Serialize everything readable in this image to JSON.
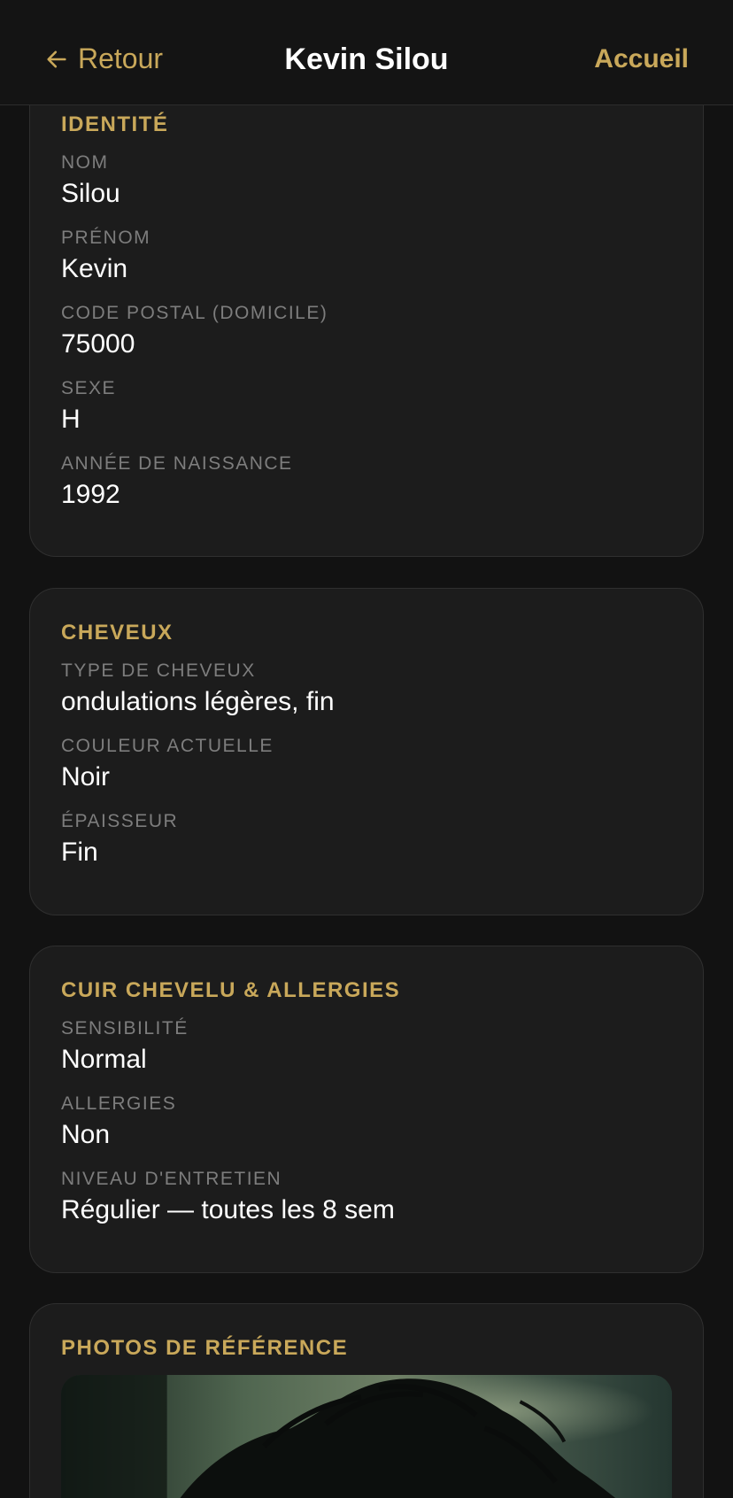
{
  "nav": {
    "back_label": "Retour",
    "title": "Kevin Silou",
    "home_label": "Accueil"
  },
  "identity": {
    "title": "IDENTITÉ",
    "fields": [
      {
        "label": "NOM",
        "value": "Silou"
      },
      {
        "label": "PRÉNOM",
        "value": "Kevin"
      },
      {
        "label": "CODE POSTAL (DOMICILE)",
        "value": "75000"
      },
      {
        "label": "SEXE",
        "value": "H"
      },
      {
        "label": "ANNÉE DE NAISSANCE",
        "value": "1992"
      }
    ]
  },
  "hair": {
    "title": "CHEVEUX",
    "fields": [
      {
        "label": "TYPE DE CHEVEUX",
        "value": "ondulations légères, fin"
      },
      {
        "label": "COULEUR ACTUELLE",
        "value": "Noir"
      },
      {
        "label": "ÉPAISSEUR",
        "value": "Fin"
      }
    ]
  },
  "scalp": {
    "title": "CUIR CHEVELU & ALLERGIES",
    "fields": [
      {
        "label": "SENSIBILITÉ",
        "value": "Normal"
      },
      {
        "label": "ALLERGIES",
        "value": "Non"
      },
      {
        "label": "NIVEAU D'ENTRETIEN",
        "value": "Régulier — toutes les 8 sem"
      }
    ]
  },
  "photos": {
    "title": "PHOTOS DE RÉFÉRENCE"
  },
  "colors": {
    "accent": "#c9a85a",
    "background": "#121212",
    "card": "#1c1c1c",
    "label": "#7d7d7d"
  }
}
